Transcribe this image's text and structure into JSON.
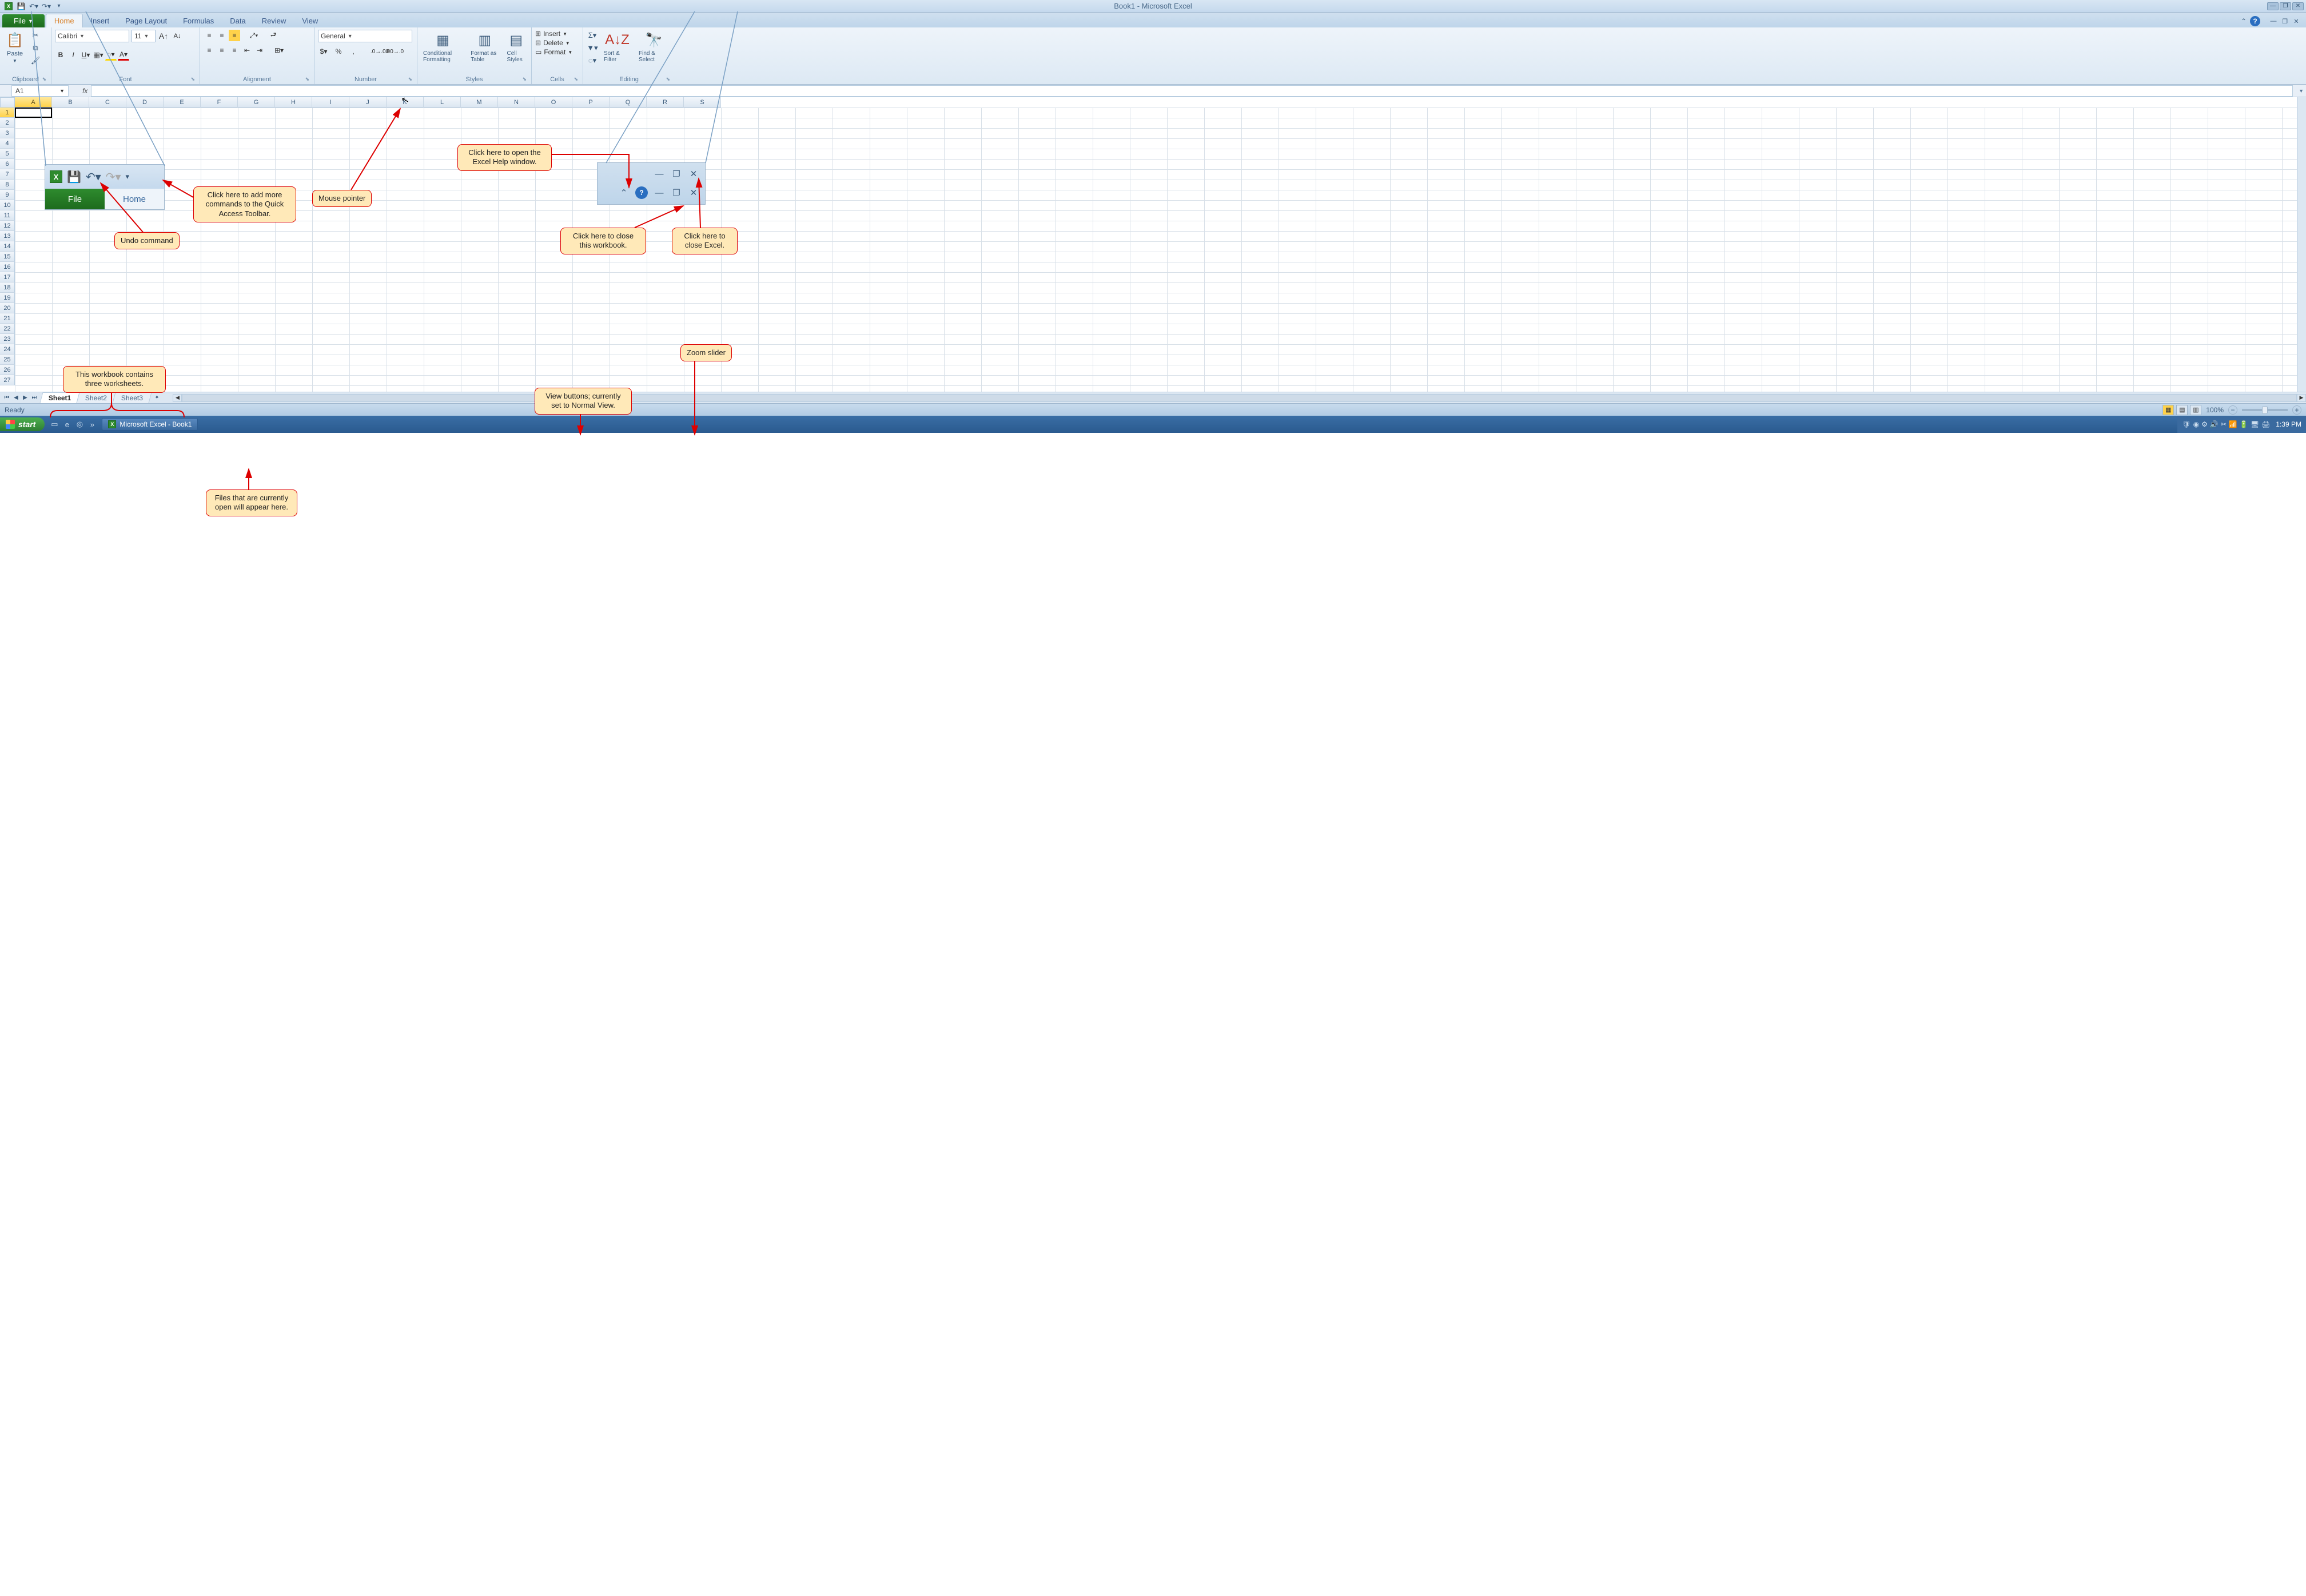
{
  "title": "Book1 - Microsoft Excel",
  "qat": {
    "save": "save-icon",
    "undo": "undo-icon",
    "redo": "redo-icon",
    "customize": "customize-icon"
  },
  "tabs": {
    "file": "File",
    "home": "Home",
    "insert": "Insert",
    "page_layout": "Page Layout",
    "formulas": "Formulas",
    "data": "Data",
    "review": "Review",
    "view": "View"
  },
  "ribbon": {
    "clipboard": {
      "label": "Clipboard",
      "paste": "Paste"
    },
    "font": {
      "label": "Font",
      "name": "Calibri",
      "size": "11"
    },
    "alignment": {
      "label": "Alignment"
    },
    "number": {
      "label": "Number",
      "format": "General"
    },
    "styles": {
      "label": "Styles",
      "cond": "Conditional Formatting",
      "table": "Format as Table",
      "cell": "Cell Styles"
    },
    "cells": {
      "label": "Cells",
      "insert": "Insert",
      "delete": "Delete",
      "format": "Format"
    },
    "editing": {
      "label": "Editing",
      "sort": "Sort & Filter",
      "find": "Find & Select"
    }
  },
  "namebox": "A1",
  "columns": [
    "A",
    "B",
    "C",
    "D",
    "E",
    "F",
    "G",
    "H",
    "I",
    "J",
    "K",
    "L",
    "M",
    "N",
    "O",
    "P",
    "Q",
    "R",
    "S"
  ],
  "rows": [
    "1",
    "2",
    "3",
    "4",
    "5",
    "6",
    "7",
    "8",
    "9",
    "10",
    "11",
    "12",
    "13",
    "14",
    "15",
    "16",
    "17",
    "18",
    "19",
    "20",
    "21",
    "22",
    "23",
    "24",
    "25",
    "26",
    "27"
  ],
  "sheets": {
    "s1": "Sheet1",
    "s2": "Sheet2",
    "s3": "Sheet3"
  },
  "status": {
    "ready": "Ready",
    "zoom": "100%"
  },
  "taskbar": {
    "start": "start",
    "app": "Microsoft Excel - Book1",
    "clock": "1:39 PM"
  },
  "inset": {
    "file": "File",
    "home": "Home"
  },
  "callouts": {
    "qat_add": "Click here to add more commands to the Quick Access Toolbar.",
    "undo": "Undo command",
    "mouse": "Mouse pointer",
    "help": "Click here to open the Excel Help window.",
    "close_wb": "Click here to close this workbook.",
    "close_excel": "Click here to close Excel.",
    "sheets": "This workbook contains three worksheets.",
    "views": "View buttons; currently set to Normal View.",
    "zoomslider": "Zoom slider",
    "files_open": "Files that are currently open will appear here."
  }
}
